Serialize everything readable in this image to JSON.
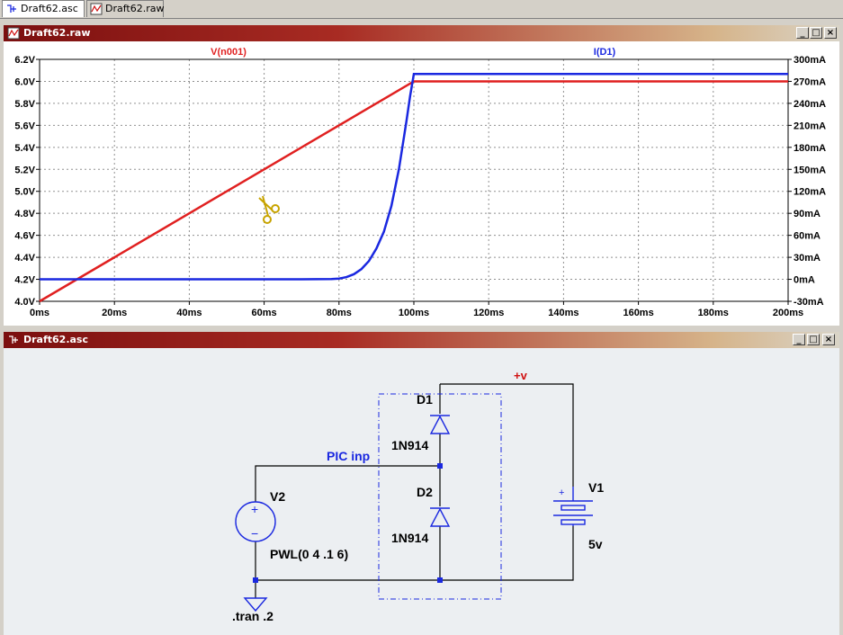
{
  "tabs": [
    {
      "label": "Draft62.asc",
      "icon": "schematic-icon"
    },
    {
      "label": "Draft62.raw",
      "icon": "waveform-icon"
    }
  ],
  "waveform_window": {
    "title": "Draft62.raw",
    "controls": [
      "_",
      "□",
      "×"
    ]
  },
  "schematic_window": {
    "title": "Draft62.asc",
    "controls": [
      "_",
      "□",
      "×"
    ]
  },
  "chart_data": {
    "type": "line",
    "series": [
      {
        "name": "V(n001)",
        "color": "#e02020",
        "axis": "left",
        "x": [
          0,
          100,
          200
        ],
        "y": [
          4.0,
          6.0,
          6.0
        ]
      },
      {
        "name": "I(D1)",
        "color": "#1a28e0",
        "axis": "right",
        "x": [
          0,
          70,
          78,
          80,
          82,
          84,
          86,
          88,
          90,
          92,
          94,
          96,
          98,
          99,
          100,
          200
        ],
        "y": [
          0,
          0,
          0.3,
          1,
          3,
          7,
          14,
          25,
          42,
          65,
          100,
          150,
          215,
          250,
          280,
          280
        ]
      }
    ],
    "xaxis": {
      "min": 0,
      "max": 200,
      "step": 20,
      "unit": "ms",
      "ticks": [
        "0ms",
        "20ms",
        "40ms",
        "60ms",
        "80ms",
        "100ms",
        "120ms",
        "140ms",
        "160ms",
        "180ms",
        "200ms"
      ]
    },
    "yleft": {
      "min": 4.0,
      "max": 6.2,
      "step": 0.2,
      "ticks": [
        "4.0V",
        "4.2V",
        "4.4V",
        "4.6V",
        "4.8V",
        "5.0V",
        "5.2V",
        "5.4V",
        "5.6V",
        "5.8V",
        "6.0V",
        "6.2V"
      ]
    },
    "yright": {
      "min": -30,
      "max": 300,
      "step": 30,
      "ticks": [
        "-30mA",
        "0mA",
        "30mA",
        "60mA",
        "90mA",
        "120mA",
        "150mA",
        "180mA",
        "210mA",
        "240mA",
        "270mA",
        "300mA"
      ]
    },
    "grid": true
  },
  "schematic": {
    "net_plus_v": "+v",
    "net_pic_inp": "PIC inp",
    "d1_name": "D1",
    "d1_model": "1N914",
    "d2_name": "D2",
    "d2_model": "1N914",
    "v1_name": "V1",
    "v1_value": "5v",
    "v2_name": "V2",
    "v2_value": "PWL(0 4 .1 6)",
    "directive": ".tran .2",
    "plus_sign": "+",
    "minus_sign": "−"
  },
  "colors": {
    "wire": "#000000",
    "net_label": "#1a1aff",
    "plus_v": "#d01010",
    "junction": "#1a1aff",
    "component": "#1a28e0"
  }
}
